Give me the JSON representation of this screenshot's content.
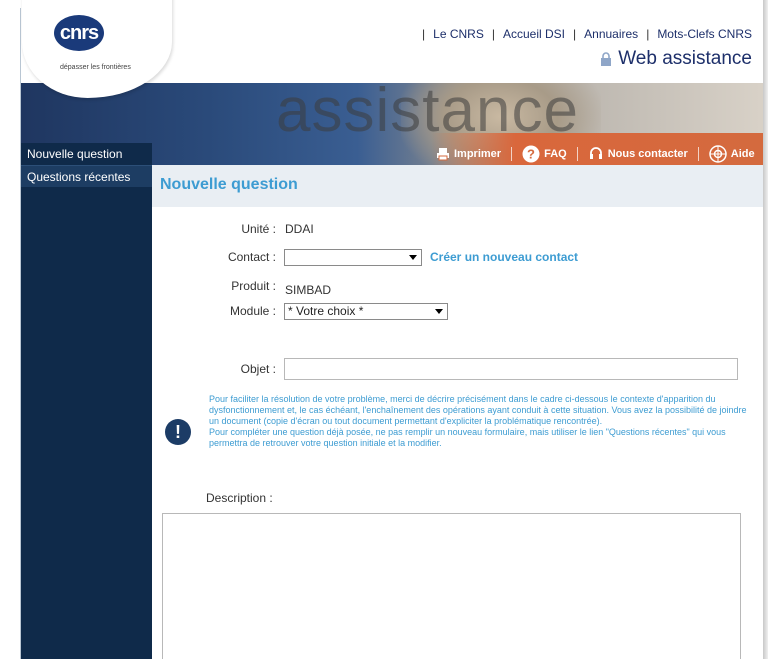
{
  "header": {
    "logo_text": "cnrs",
    "tagline": "dépasser les frontières",
    "links": [
      "Le CNRS",
      "Accueil DSI",
      "Annuaires",
      "Mots-Clefs CNRS"
    ],
    "subtitle": "Web assistance",
    "banner_word": "assistance"
  },
  "actions": {
    "print": "Imprimer",
    "faq": "FAQ",
    "contact": "Nous contacter",
    "help": "Aide"
  },
  "sidebar": {
    "items": [
      {
        "label": "Nouvelle question"
      },
      {
        "label": "Questions récentes"
      }
    ]
  },
  "form": {
    "title": "Nouvelle question",
    "unite_label": "Unité :",
    "unite_value": "DDAI",
    "contact_label": "Contact :",
    "contact_value": "",
    "new_contact_link": "Créer un nouveau contact",
    "produit_label": "Produit :",
    "produit_value": "SIMBAD",
    "module_label": "Module :",
    "module_value": "* Votre choix *",
    "objet_label": "Objet :",
    "objet_value": "",
    "info_p1": "Pour faciliter la résolution de votre problème, merci de décrire précisément dans le cadre ci-dessous le contexte d'apparition du dysfonctionnement et, le cas échéant, l'enchaînement des opérations ayant conduit à cette situation. Vous avez la possibilité de joindre un document (copie d'écran ou tout document permettant d'expliciter la problématique rencontrée).",
    "info_p2": "Pour compléter une question déjà posée, ne pas remplir un nouveau formulaire, mais utiliser le lien \"Questions récentes\" qui vous permettra de retrouver votre question initiale et la modifier.",
    "description_label": "Description :",
    "description_value": ""
  },
  "colors": {
    "navy": "#0f2a4a",
    "accent_blue": "#3d9cd2",
    "banner_orange": "#d46a3e"
  }
}
